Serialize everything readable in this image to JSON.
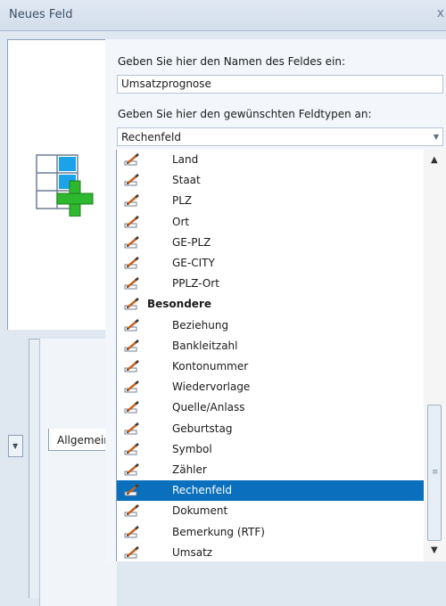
{
  "window": {
    "title": "Neues Feld",
    "close_glyph": "x"
  },
  "form": {
    "name_label": "Geben Sie hier den Namen des Feldes ein:",
    "name_value": "Umsatzprognose",
    "type_label": "Geben Sie hier den gewünschten Feldtypen an:",
    "type_value": "Rechenfeld"
  },
  "tab": {
    "label": "Allgemein"
  },
  "list": [
    {
      "label": "Land",
      "kind": "item"
    },
    {
      "label": "Staat",
      "kind": "item"
    },
    {
      "label": "PLZ",
      "kind": "item"
    },
    {
      "label": "Ort",
      "kind": "item"
    },
    {
      "label": "GE-PLZ",
      "kind": "item"
    },
    {
      "label": "GE-CITY",
      "kind": "item"
    },
    {
      "label": "PPLZ-Ort",
      "kind": "item"
    },
    {
      "label": "Besondere",
      "kind": "header"
    },
    {
      "label": "Beziehung",
      "kind": "item"
    },
    {
      "label": "Bankleitzahl",
      "kind": "item"
    },
    {
      "label": "Kontonummer",
      "kind": "item"
    },
    {
      "label": "Wiedervorlage",
      "kind": "item"
    },
    {
      "label": "Quelle/Anlass",
      "kind": "item"
    },
    {
      "label": "Geburtstag",
      "kind": "item"
    },
    {
      "label": "Symbol",
      "kind": "item"
    },
    {
      "label": "Zähler",
      "kind": "item"
    },
    {
      "label": "Rechenfeld",
      "kind": "item",
      "selected": true
    },
    {
      "label": "Dokument",
      "kind": "item"
    },
    {
      "label": "Bemerkung (RTF)",
      "kind": "item"
    },
    {
      "label": "Umsatz",
      "kind": "item"
    }
  ],
  "colors": {
    "selection": "#0a6fbd",
    "accent_green": "#2eb82e",
    "accent_blue": "#1aa3e8"
  },
  "icons": {
    "field_type": "pencil-field-icon",
    "new_field": "table-plus-icon"
  }
}
